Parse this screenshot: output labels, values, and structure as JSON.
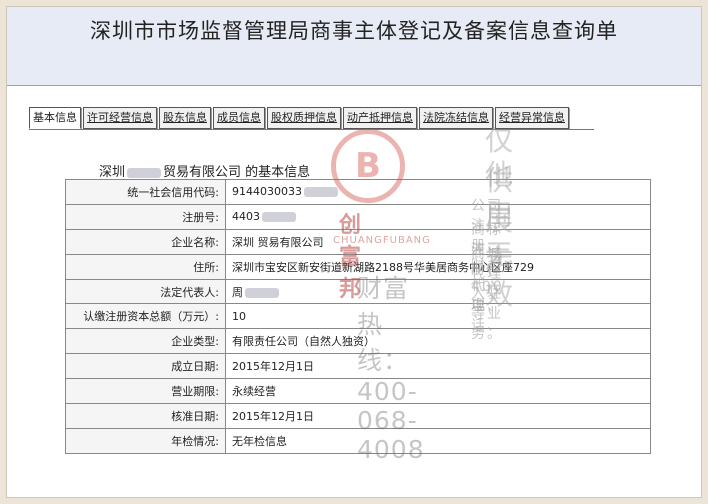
{
  "page": {
    "title": "深圳市市场监督管理局商事主体登记及备案信息查询单"
  },
  "tabs": [
    {
      "label": "基本信息",
      "active": true
    },
    {
      "label": "许可经营信息",
      "active": false
    },
    {
      "label": "股东信息",
      "active": false
    },
    {
      "label": "成员信息",
      "active": false
    },
    {
      "label": "股权质押信息",
      "active": false
    },
    {
      "label": "动产抵押信息",
      "active": false
    },
    {
      "label": "法院冻结信息",
      "active": false
    },
    {
      "label": "经营异常信息",
      "active": false
    }
  ],
  "section": {
    "title_prefix": "深圳",
    "title_suffix": "贸易有限公司  的基本信息"
  },
  "rows": [
    {
      "label": "统一社会信用代码:",
      "value": "9144030033"
    },
    {
      "label": "注册号:",
      "value": "4403"
    },
    {
      "label": "企业名称:",
      "value": "深圳      贸易有限公司"
    },
    {
      "label": "住所:",
      "value": "深圳市宝安区新安街道新湖路2188号华美居商务中心区座729"
    },
    {
      "label": "法定代表人:",
      "value": "周"
    },
    {
      "label": "认缴注册资本总额（万元）:",
      "value": "10"
    },
    {
      "label": "企业类型:",
      "value": "有限责任公司（自然人独资）"
    },
    {
      "label": "成立日期:",
      "value": "2015年12月1日"
    },
    {
      "label": "营业期限:",
      "value": "永续经营"
    },
    {
      "label": "核准日期:",
      "value": "2015年12月1日"
    },
    {
      "label": "年检情况:",
      "value": "无年检信息"
    }
  ],
  "watermark": {
    "logo_glyph": "B",
    "brand_cn": "创富邦",
    "brand_en": "CHUANGFUBANG",
    "line1": "仅供展示",
    "line2": "他用无效",
    "service1": "公司注册、财务代理、",
    "service2": "商标注册、400电话、",
    "service3": "商城代理入驻等业务。",
    "hotline": "财富热线：400-068-4008"
  }
}
